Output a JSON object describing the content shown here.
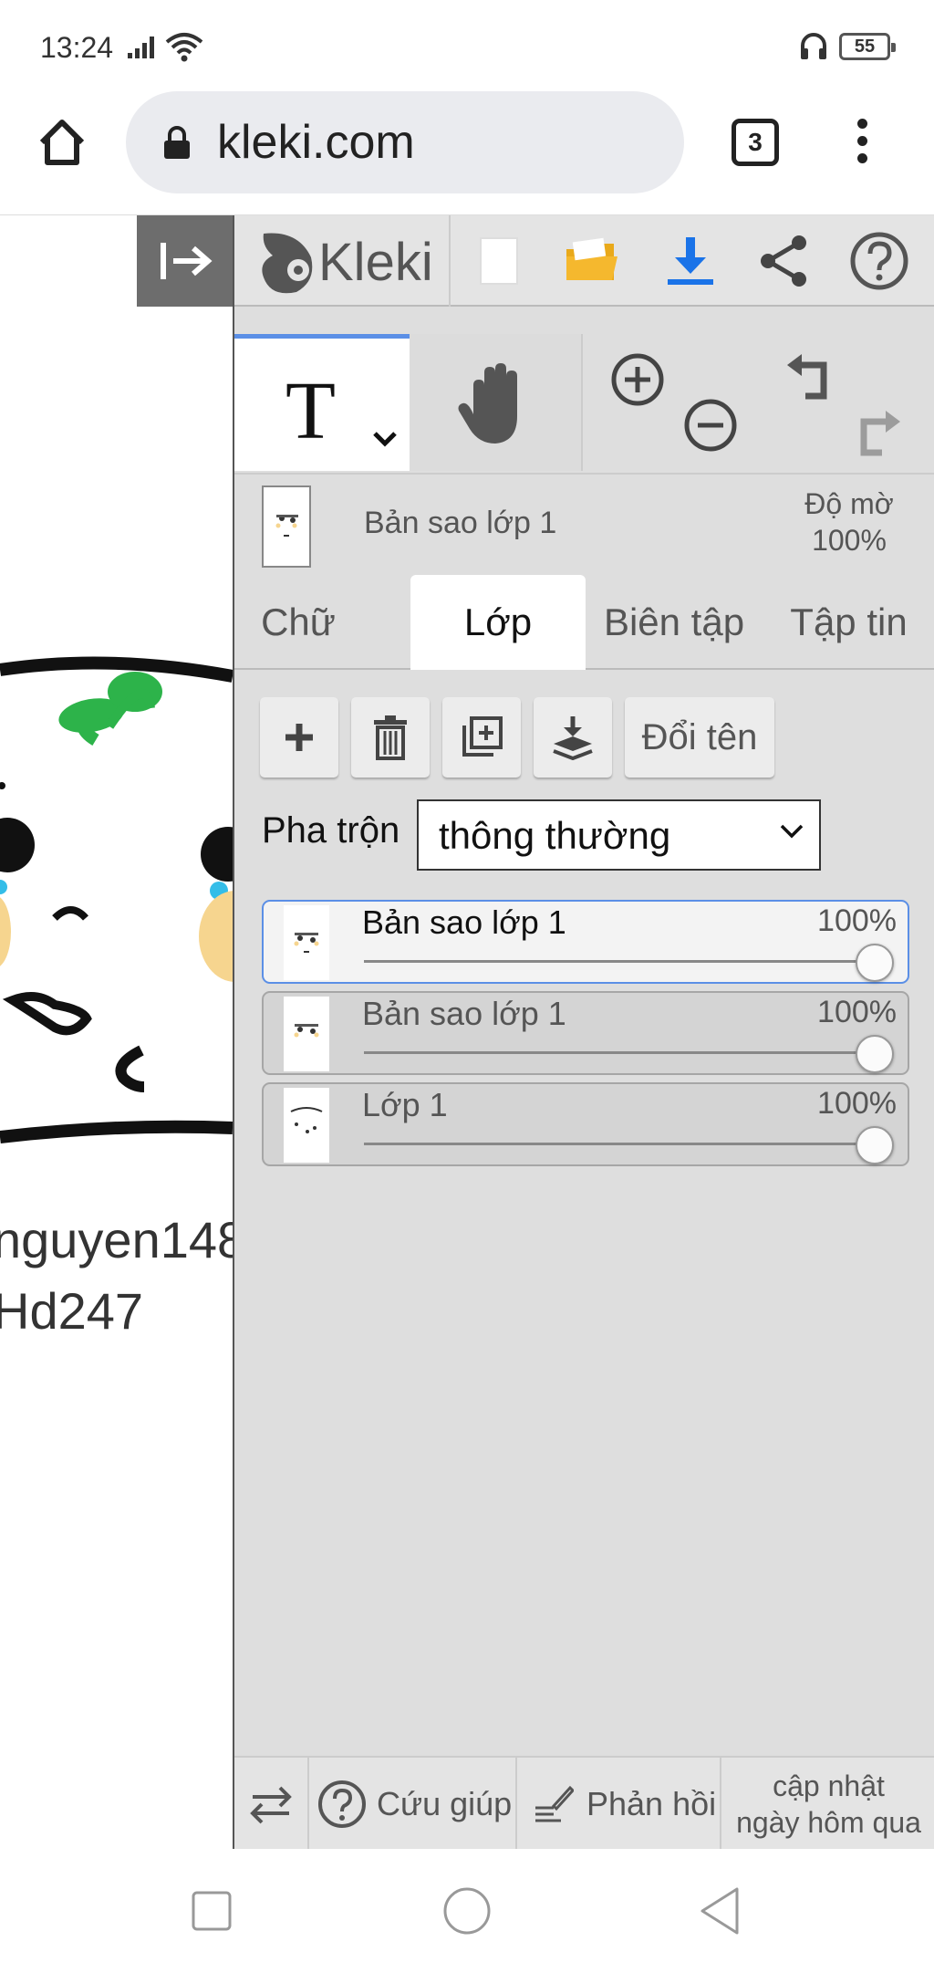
{
  "status": {
    "time": "13:24",
    "battery": "55"
  },
  "browser": {
    "url": "kleki.com",
    "tab_count": "3"
  },
  "canvas": {
    "text_line1": "nguyen148",
    "text_line2": "Hd247"
  },
  "app": {
    "logo_text": "Kleki",
    "colors": {
      "accent": "#5b8fe6",
      "download_icon": "#1a73e8",
      "folder_icon": "#f5b82e",
      "panel_bg": "#dedede",
      "sprout_green": "#2db34a",
      "tear_blue": "#34bde8",
      "cheek_yellow": "#f6d58f"
    }
  },
  "tools": {
    "text_tool_label": "T"
  },
  "layer_header": {
    "name": "Bản sao lớp 1",
    "opacity_label": "Độ mờ",
    "opacity_value": "100%"
  },
  "tabs": [
    {
      "label": "Chữ"
    },
    {
      "label": "Lớp"
    },
    {
      "label": "Biên tập"
    },
    {
      "label": "Tập tin"
    }
  ],
  "layer_actions": {
    "rename_label": "Đổi tên"
  },
  "blend": {
    "label": "Pha trộn",
    "value": "thông thường"
  },
  "layers": [
    {
      "name": "Bản sao lớp 1",
      "opacity": "100%",
      "opacity_value": 1.0,
      "selected": true
    },
    {
      "name": "Bản sao lớp 1",
      "opacity": "100%",
      "opacity_value": 1.0,
      "selected": false
    },
    {
      "name": "Lớp 1",
      "opacity": "100%",
      "opacity_value": 1.0,
      "selected": false
    }
  ],
  "bottom": {
    "help_label": "Cứu giúp",
    "feedback_label": "Phản hồi",
    "update_line1": "cập nhật",
    "update_line2": "ngày hôm qua"
  }
}
